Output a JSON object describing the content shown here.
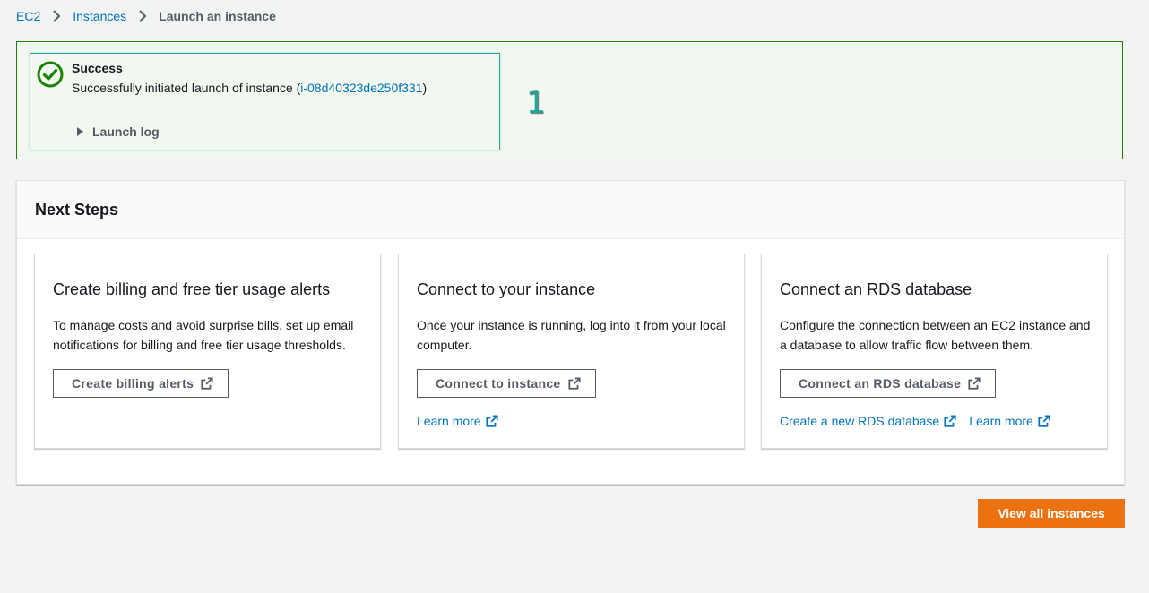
{
  "breadcrumb": {
    "items": [
      "EC2",
      "Instances"
    ],
    "current": "Launch an instance"
  },
  "success": {
    "title": "Success",
    "message_prefix": "Successfully initiated launch of instance (",
    "instance_id": "i-08d40323de250f331",
    "message_suffix": ")",
    "launch_log_label": "Launch log"
  },
  "annotation": {
    "step_number": "1"
  },
  "next_steps": {
    "title": "Next Steps",
    "cards": [
      {
        "title": "Create billing and free tier usage alerts",
        "description": "To manage costs and avoid surprise bills, set up email notifications for billing and free tier usage thresholds.",
        "button_label": "Create billing alerts",
        "links": []
      },
      {
        "title": "Connect to your instance",
        "description": "Once your instance is running, log into it from your local computer.",
        "button_label": "Connect to instance",
        "links": [
          "Learn more"
        ]
      },
      {
        "title": "Connect an RDS database",
        "description": "Configure the connection between an EC2 instance and a database to allow traffic flow between them.",
        "button_label": "Connect an RDS database",
        "links": [
          "Create a new RDS database",
          "Learn more"
        ]
      }
    ]
  },
  "view_all_label": "View all instances",
  "colors": {
    "link": "#0073bb",
    "success_border": "#1d8102",
    "success_bg": "#f2f8f0",
    "primary_button": "#ec7211"
  },
  "icons": {
    "success": "check-circle-icon",
    "external": "external-link-icon",
    "breadcrumb_sep": "chevron-right-icon"
  }
}
